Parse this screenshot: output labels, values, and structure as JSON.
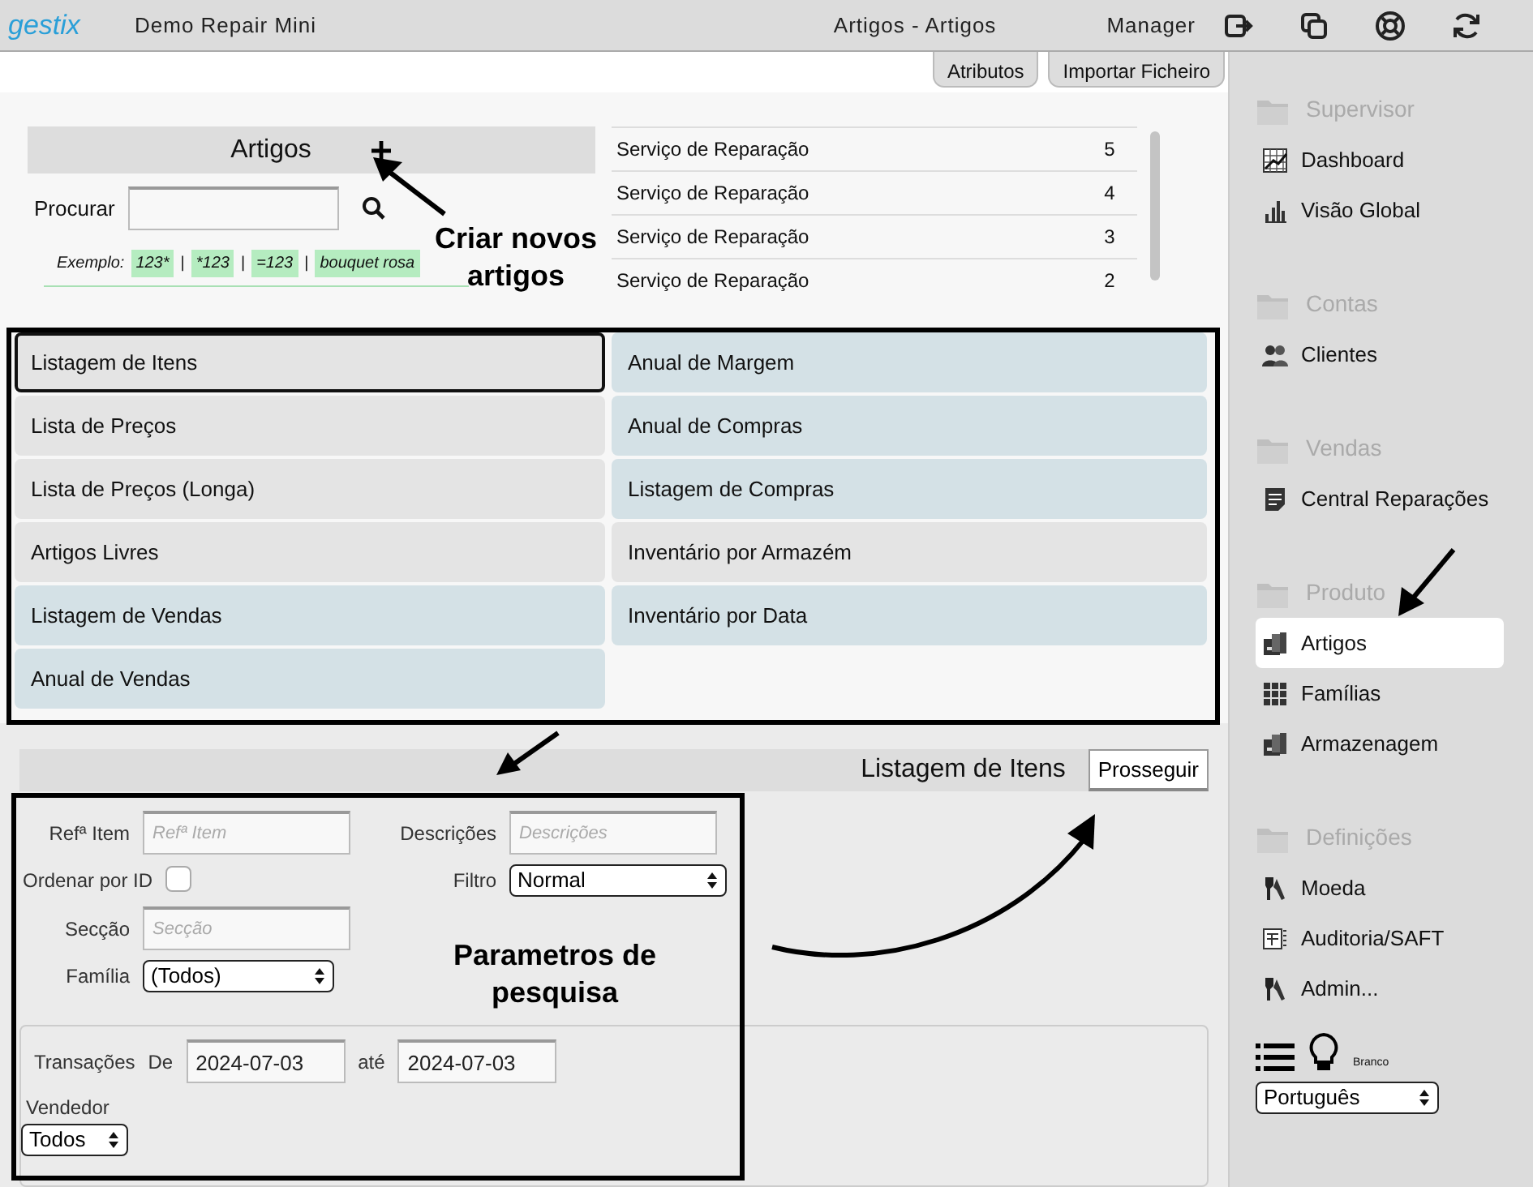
{
  "topbar": {
    "logo": "gestix",
    "company": "Demo Repair Mini",
    "page_title": "Artigos - Artigos",
    "user": "Manager"
  },
  "tabs": [
    {
      "label": "Atributos"
    },
    {
      "label": "Importar Ficheiro"
    }
  ],
  "articles_panel": {
    "title": "Artigos",
    "search_label": "Procurar",
    "example_label": "Exemplo:",
    "separator": "|",
    "examples": [
      "123*",
      "*123",
      "=123",
      "bouquet rosa"
    ]
  },
  "recent_items": [
    {
      "name": "Serviço de Reparação",
      "number": "5"
    },
    {
      "name": "Serviço de Reparação",
      "number": "4"
    },
    {
      "name": "Serviço de Reparação",
      "number": "3"
    },
    {
      "name": "Serviço de Reparação",
      "number": "2"
    }
  ],
  "reports": [
    [
      {
        "label": "Listagem de Itens",
        "color": "#e4e4e4",
        "selected": true
      },
      {
        "label": "Lista de Preços",
        "color": "#e4e4e4",
        "selected": false
      },
      {
        "label": "Lista de Preços (Longa)",
        "color": "#e4e4e4",
        "selected": false
      },
      {
        "label": "Artigos Livres",
        "color": "#e4e4e4",
        "selected": false
      },
      {
        "label": "Listagem de Vendas",
        "color": "#d4e1e6",
        "selected": false
      },
      {
        "label": "Anual de Vendas",
        "color": "#d4e1e6",
        "selected": false
      }
    ],
    [
      {
        "label": "Anual de Margem",
        "color": "#d4e1e6",
        "selected": false
      },
      {
        "label": "Anual de Compras",
        "color": "#d4e1e6",
        "selected": false
      },
      {
        "label": "Listagem de Compras",
        "color": "#d4e1e6",
        "selected": false
      },
      {
        "label": "Inventário por Armazém",
        "color": "#e4e4e4",
        "selected": false
      },
      {
        "label": "Inventário por Data",
        "color": "#d4e1e6",
        "selected": false
      }
    ]
  ],
  "parameters": {
    "title": "Listagem de Itens",
    "submit": "Prosseguir",
    "ref_label": "Refª Item",
    "ref_placeholder": "Refª Item",
    "desc_label": "Descrições",
    "desc_placeholder": "Descrições",
    "order_label": "Ordenar por ID",
    "order_checked": false,
    "filter_label": "Filtro",
    "filter_value": "Normal",
    "section_label": "Secção",
    "section_placeholder": "Secção",
    "family_label": "Família",
    "family_value": "(Todos)",
    "transactions_label": "Transações",
    "from_label": "De",
    "from_value": "2024-07-03",
    "to_label": "até",
    "to_value": "2024-07-03",
    "seller_label": "Vendedor",
    "seller_value": "Todos"
  },
  "annotations": [
    {
      "text": "Criar novos artigos"
    },
    {
      "text": "Parametros de pesquisa"
    }
  ],
  "sidebar": {
    "sections": [
      {
        "title": "Supervisor",
        "items": [
          {
            "label": "Dashboard",
            "kind": "chart",
            "selected": false
          },
          {
            "label": "Visão Global",
            "kind": "bars",
            "selected": false
          }
        ]
      },
      {
        "title": "Contas",
        "items": [
          {
            "label": "Clientes",
            "kind": "people",
            "selected": false
          }
        ]
      },
      {
        "title": "Vendas",
        "items": [
          {
            "label": "Central Reparações",
            "kind": "doc",
            "selected": false
          }
        ]
      },
      {
        "title": "Produto",
        "items": [
          {
            "label": "Artigos",
            "kind": "boxes",
            "selected": true
          },
          {
            "label": "Famílias",
            "kind": "grid",
            "selected": false
          },
          {
            "label": "Armazenagem",
            "kind": "boxes",
            "selected": false
          }
        ]
      },
      {
        "title": "Definições",
        "items": [
          {
            "label": "Moeda",
            "kind": "keys",
            "selected": false
          },
          {
            "label": "Auditoria/SAFT",
            "kind": "audit",
            "selected": false
          },
          {
            "label": "Admin...",
            "kind": "keys",
            "selected": false
          }
        ]
      }
    ],
    "theme_label": "Branco",
    "language": "Português"
  }
}
